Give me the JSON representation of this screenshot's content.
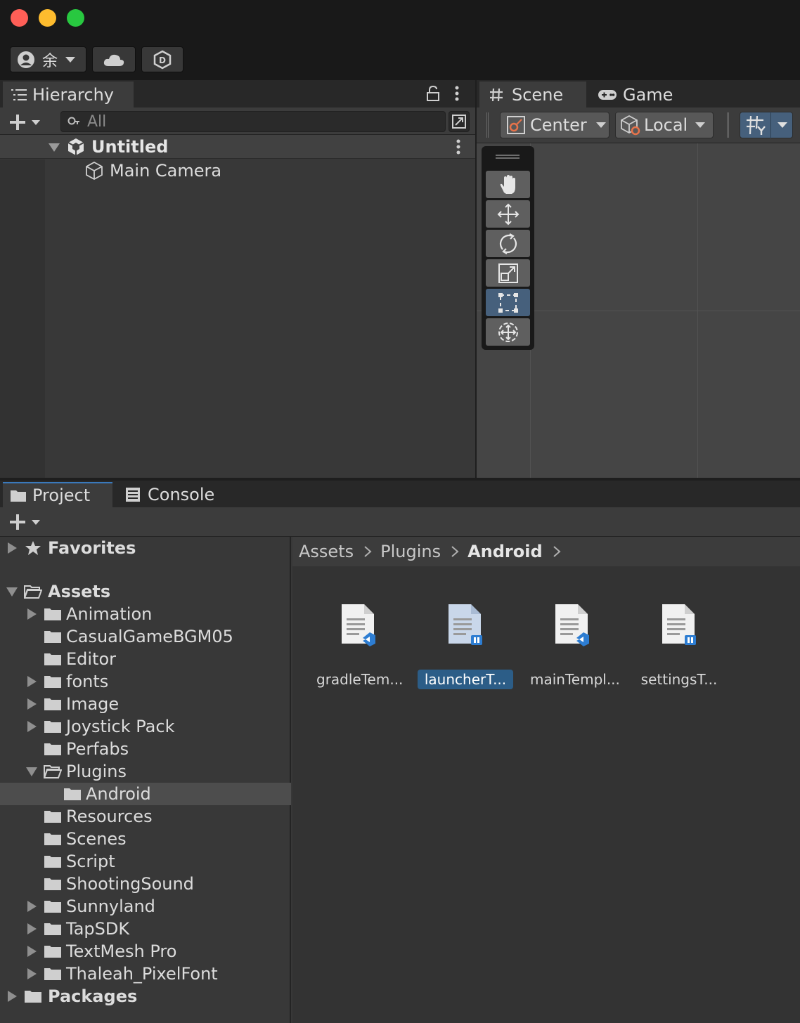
{
  "titlebar": {
    "account_label": "余",
    "account_icon": "person-circle-icon",
    "cloud_icon": "cloud-icon",
    "collab_icon": "hexagon-d-icon"
  },
  "hierarchy": {
    "tab_label": "Hierarchy",
    "search_placeholder": "All",
    "scene_name": "Untitled",
    "objects": [
      "Main Camera"
    ]
  },
  "scene_view": {
    "tabs": [
      "Scene",
      "Game"
    ],
    "pivot_label": "Center",
    "space_label": "Local",
    "tools": [
      "hand-tool-icon",
      "move-tool-icon",
      "rotate-tool-icon",
      "scale-tool-icon",
      "rect-tool-icon",
      "transform-tool-icon"
    ],
    "selected_tool": 4
  },
  "project": {
    "tabs": [
      "Project",
      "Console"
    ],
    "tree": [
      {
        "label": "Favorites",
        "bold": true,
        "depth": 0,
        "arrow": "right",
        "icon": "star"
      },
      {
        "label": "Assets",
        "bold": true,
        "depth": 0,
        "arrow": "down",
        "icon": "folder-open"
      },
      {
        "label": "Animation",
        "depth": 1,
        "arrow": "right",
        "icon": "folder"
      },
      {
        "label": "CasualGameBGM05",
        "depth": 1,
        "arrow": "",
        "icon": "folder"
      },
      {
        "label": "Editor",
        "depth": 1,
        "arrow": "",
        "icon": "folder"
      },
      {
        "label": "fonts",
        "depth": 1,
        "arrow": "right",
        "icon": "folder"
      },
      {
        "label": "Image",
        "depth": 1,
        "arrow": "right",
        "icon": "folder"
      },
      {
        "label": "Joystick Pack",
        "depth": 1,
        "arrow": "right",
        "icon": "folder"
      },
      {
        "label": "Perfabs",
        "depth": 1,
        "arrow": "",
        "icon": "folder"
      },
      {
        "label": "Plugins",
        "depth": 1,
        "arrow": "down",
        "icon": "folder-open"
      },
      {
        "label": "Android",
        "depth": 2,
        "arrow": "",
        "icon": "folder",
        "selected": true
      },
      {
        "label": "Resources",
        "depth": 1,
        "arrow": "",
        "icon": "folder"
      },
      {
        "label": "Scenes",
        "depth": 1,
        "arrow": "",
        "icon": "folder"
      },
      {
        "label": "Script",
        "depth": 1,
        "arrow": "",
        "icon": "folder"
      },
      {
        "label": "ShootingSound",
        "depth": 1,
        "arrow": "",
        "icon": "folder"
      },
      {
        "label": "Sunnyland",
        "depth": 1,
        "arrow": "right",
        "icon": "folder"
      },
      {
        "label": "TapSDK",
        "depth": 1,
        "arrow": "right",
        "icon": "folder"
      },
      {
        "label": "TextMesh Pro",
        "depth": 1,
        "arrow": "right",
        "icon": "folder"
      },
      {
        "label": "Thaleah_PixelFont",
        "depth": 1,
        "arrow": "right",
        "icon": "folder"
      },
      {
        "label": "Packages",
        "bold": true,
        "depth": 0,
        "arrow": "right",
        "icon": "folder"
      }
    ],
    "breadcrumbs": [
      "Assets",
      "Plugins",
      "Android"
    ],
    "assets": [
      {
        "label": "gradleTem...",
        "selected": false
      },
      {
        "label": "launcherT...",
        "selected": true
      },
      {
        "label": "mainTempl...",
        "selected": false
      },
      {
        "label": "settingsT...",
        "selected": false
      }
    ]
  },
  "colors": {
    "selection_blue": "#2c5d87",
    "tool_selected": "#46607c"
  }
}
